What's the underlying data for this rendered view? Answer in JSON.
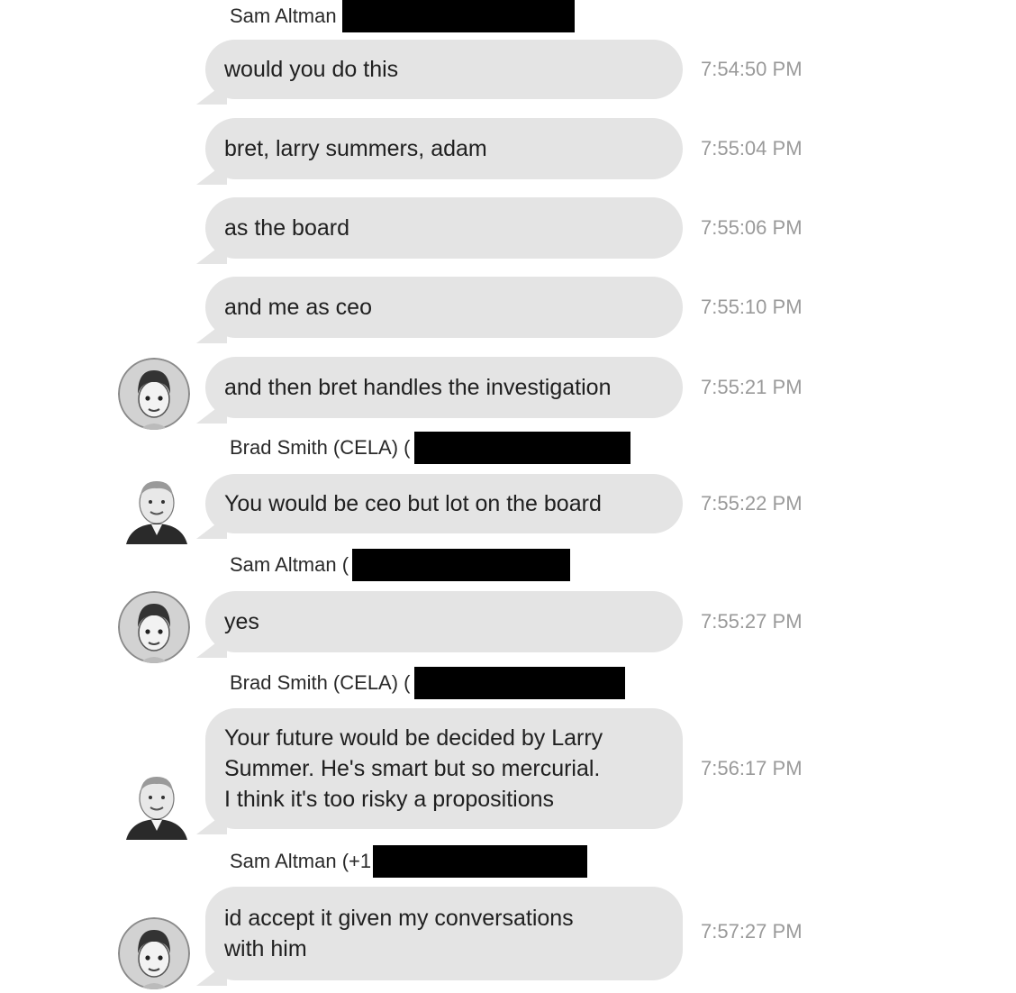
{
  "thread": {
    "sections": [
      {
        "sender": "Sam Altman",
        "messages": [
          {
            "text": "would you do this",
            "time": "7:54:50 PM"
          },
          {
            "text": "bret, larry summers, adam",
            "time": "7:55:04 PM"
          },
          {
            "text": "as the board",
            "time": "7:55:06 PM"
          },
          {
            "text": "and me as ceo",
            "time": "7:55:10 PM"
          },
          {
            "text": "and then bret handles the investigation",
            "time": "7:55:21 PM"
          }
        ]
      },
      {
        "sender": "Brad Smith (CELA) (",
        "messages": [
          {
            "text": "You would be ceo but lot on the board",
            "time": "7:55:22 PM"
          }
        ]
      },
      {
        "sender": "Sam Altman (",
        "messages": [
          {
            "text": "yes",
            "time": "7:55:27 PM"
          }
        ]
      },
      {
        "sender": "Brad Smith (CELA) (",
        "messages": [
          {
            "text": "Your future would be decided by Larry\nSummer. He's smart but so mercurial.\nI think it's too risky a propositions",
            "time": "7:56:17 PM"
          }
        ]
      },
      {
        "sender": "Sam Altman (+1",
        "messages": [
          {
            "text": "id accept it given my conversations\nwith him",
            "time": "7:57:27 PM"
          }
        ]
      }
    ]
  },
  "avatars": {
    "sam": "memoji-avatar-icon",
    "brad": "contact-photo-icon"
  },
  "colors": {
    "bubble": "#e4e4e4",
    "timestamp": "#9a9a9a",
    "redaction": "#000000",
    "text": "#202020"
  }
}
